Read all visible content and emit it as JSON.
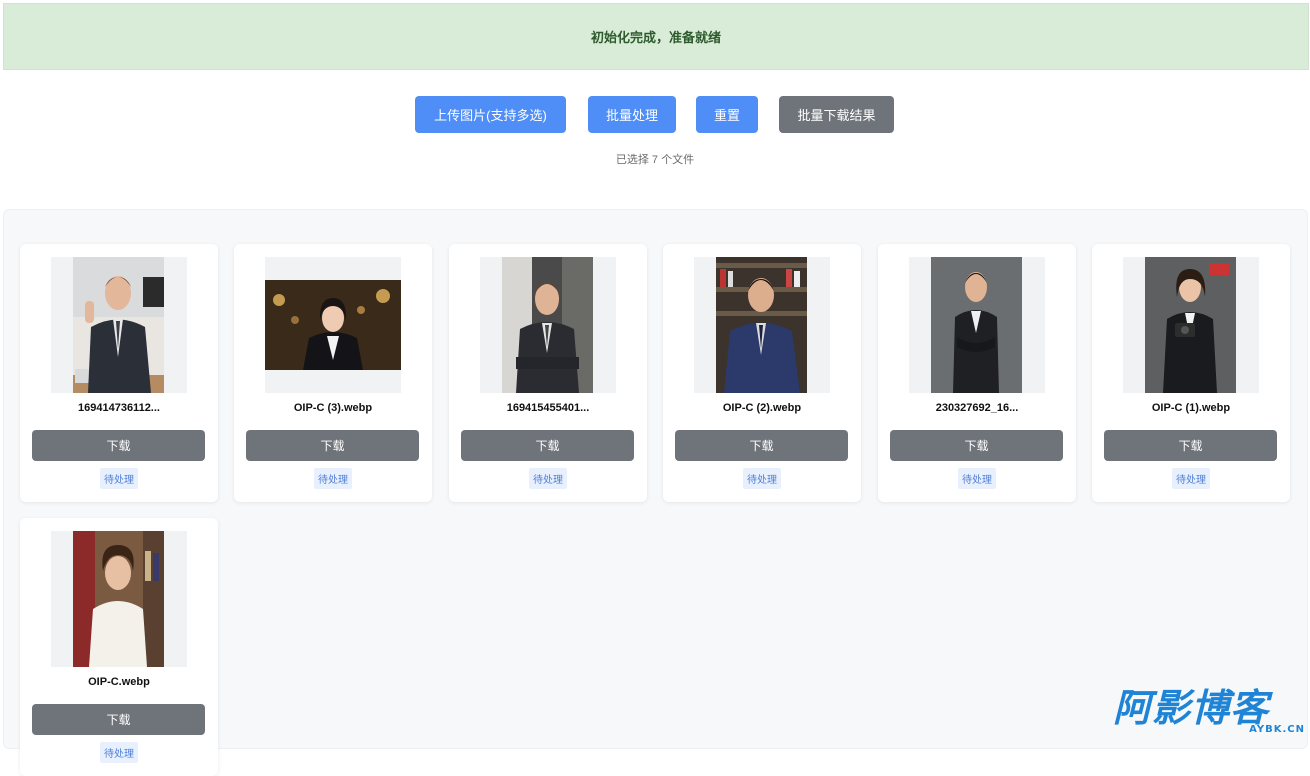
{
  "status_banner": {
    "text": "初始化完成，准备就绪"
  },
  "toolbar": {
    "upload_label": "上传图片(支持多选)",
    "batch_label": "批量处理",
    "reset_label": "重置",
    "download_all_label": "批量下载结果"
  },
  "selection": {
    "text": "已选择 7 个文件"
  },
  "cards": [
    {
      "name": "169414736112...",
      "download_label": "下载",
      "status": "待处理"
    },
    {
      "name": "OIP-C (3).webp",
      "download_label": "下载",
      "status": "待处理"
    },
    {
      "name": "169415455401...",
      "download_label": "下载",
      "status": "待处理"
    },
    {
      "name": "OIP-C (2).webp",
      "download_label": "下载",
      "status": "待处理"
    },
    {
      "name": "230327692_16...",
      "download_label": "下载",
      "status": "待处理"
    },
    {
      "name": "OIP-C (1).webp",
      "download_label": "下载",
      "status": "待处理"
    },
    {
      "name": "OIP-C.webp",
      "download_label": "下载",
      "status": "待处理"
    }
  ],
  "watermark": {
    "main": "阿影博客",
    "sub": "AYBK.CN"
  },
  "colors": {
    "primary": "#4f8df7",
    "secondary": "#6f747b",
    "success_bg": "#d8ecd8"
  }
}
